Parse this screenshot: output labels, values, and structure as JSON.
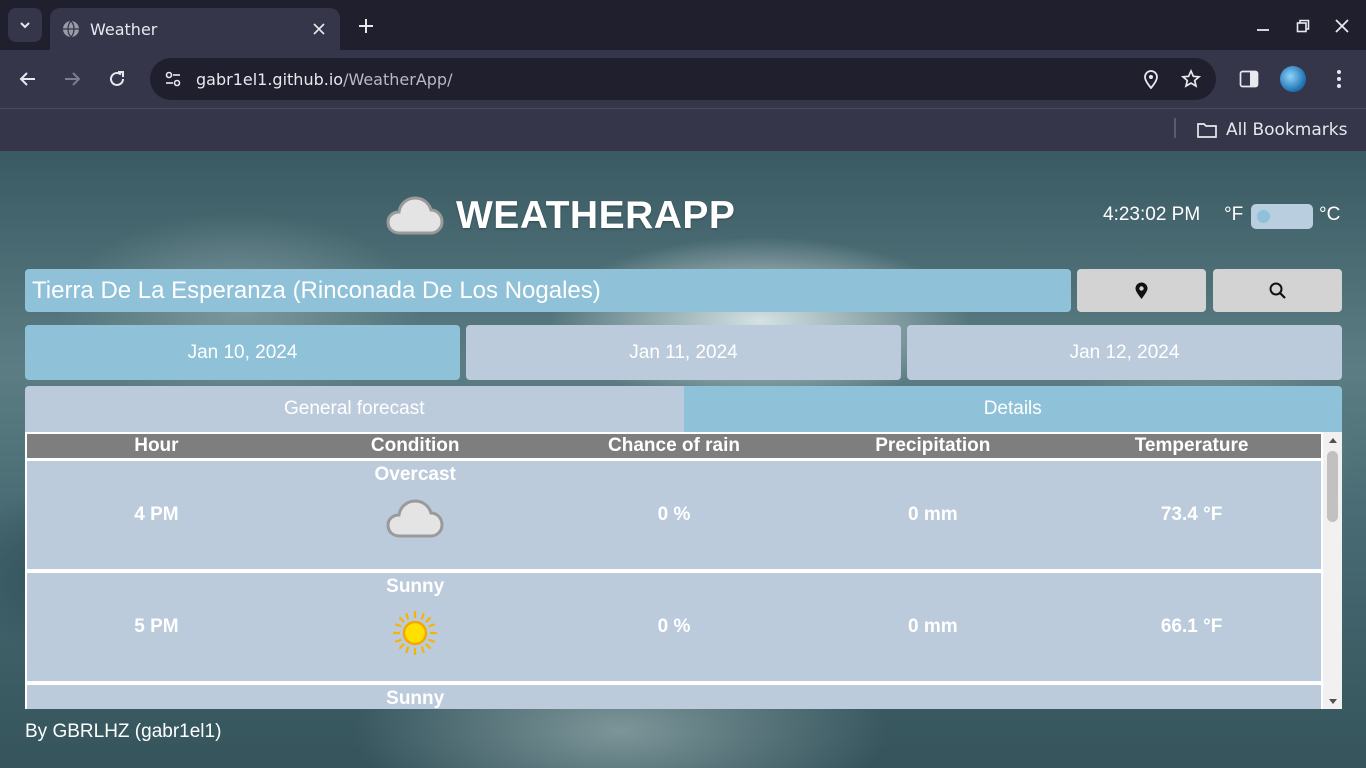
{
  "browser": {
    "tab_title": "Weather",
    "url_host": "gabr1el1.github.io",
    "url_path": "/WeatherApp/",
    "bookmarks_label": "All Bookmarks"
  },
  "app": {
    "title": "WEATHERAPP",
    "time": "4:23:02 PM",
    "unit_f": "°F",
    "unit_c": "°C",
    "search_value": "Tierra De La Esperanza (Rinconada De Los Nogales)",
    "days": [
      "Jan 10, 2024",
      "Jan 11, 2024",
      "Jan 12, 2024"
    ],
    "view_tabs": {
      "general": "General forecast",
      "details": "Details"
    },
    "table": {
      "headers": [
        "Hour",
        "Condition",
        "Chance of rain",
        "Precipitation",
        "Temperature"
      ],
      "rows": [
        {
          "hour": "4 PM",
          "condition": "Overcast",
          "icon": "cloud-icon",
          "rain_chance": "0 %",
          "precipitation": "0 mm",
          "temperature": "73.4 °F"
        },
        {
          "hour": "5 PM",
          "condition": "Sunny",
          "icon": "sun-icon",
          "rain_chance": "0 %",
          "precipitation": "0 mm",
          "temperature": "66.1 °F"
        },
        {
          "hour": "",
          "condition": "Sunny",
          "icon": "sun-icon",
          "rain_chance": "",
          "precipitation": "",
          "temperature": ""
        }
      ]
    },
    "footer": "By GBRLHZ (gabr1el1)"
  },
  "colors": {
    "accent_blue": "#8fc1d8",
    "panel_gray_blue": "#bccbdc",
    "header_gray": "#7e7e7e",
    "button_gray": "#d3d3d3"
  }
}
